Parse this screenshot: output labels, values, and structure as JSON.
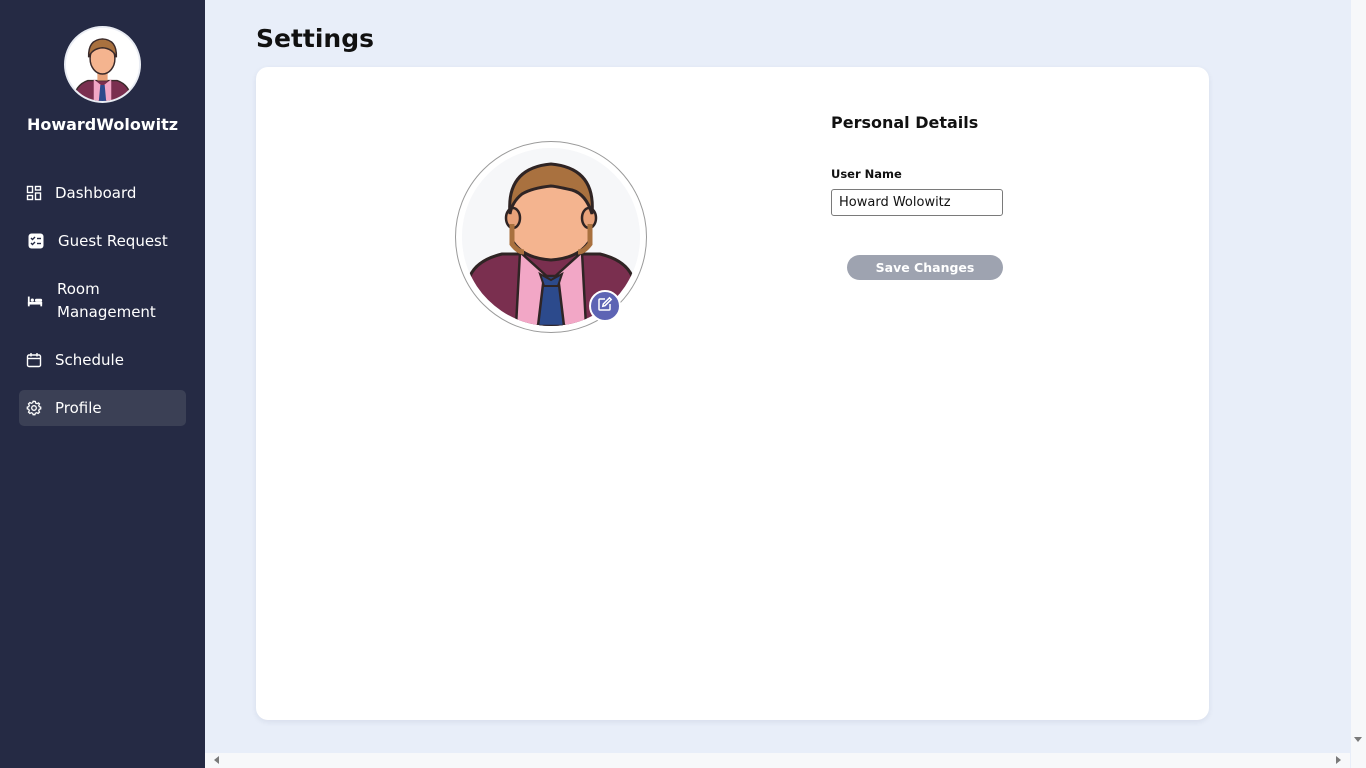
{
  "sidebar": {
    "user_name": "HowardWolowitz",
    "avatar_icon": "user-avatar-icon",
    "items": [
      {
        "label": "Dashboard",
        "icon": "dashboard-icon"
      },
      {
        "label": "Guest Request",
        "icon": "checklist-icon"
      },
      {
        "label": "Room",
        "label2": "Management",
        "icon": "bed-icon"
      },
      {
        "label": "Schedule",
        "icon": "calendar-icon"
      },
      {
        "label": "Profile",
        "icon": "gear-icon",
        "active": true
      }
    ],
    "colors": {
      "background": "#252a44",
      "active": "#3b4055"
    }
  },
  "main": {
    "title": "Settings",
    "profile_avatar_icon": "user-avatar-icon",
    "edit_icon": "edit-pencil-icon",
    "personal_details": {
      "heading": "Personal Details",
      "user_name_label": "User Name",
      "user_name_value": "Howard Wolowitz",
      "save_label": "Save Changes"
    },
    "colors": {
      "page_bg": "#e8eef9",
      "card_bg": "#ffffff",
      "save_button": "#9ea3b0",
      "edit_button": "#5d64b4"
    }
  }
}
